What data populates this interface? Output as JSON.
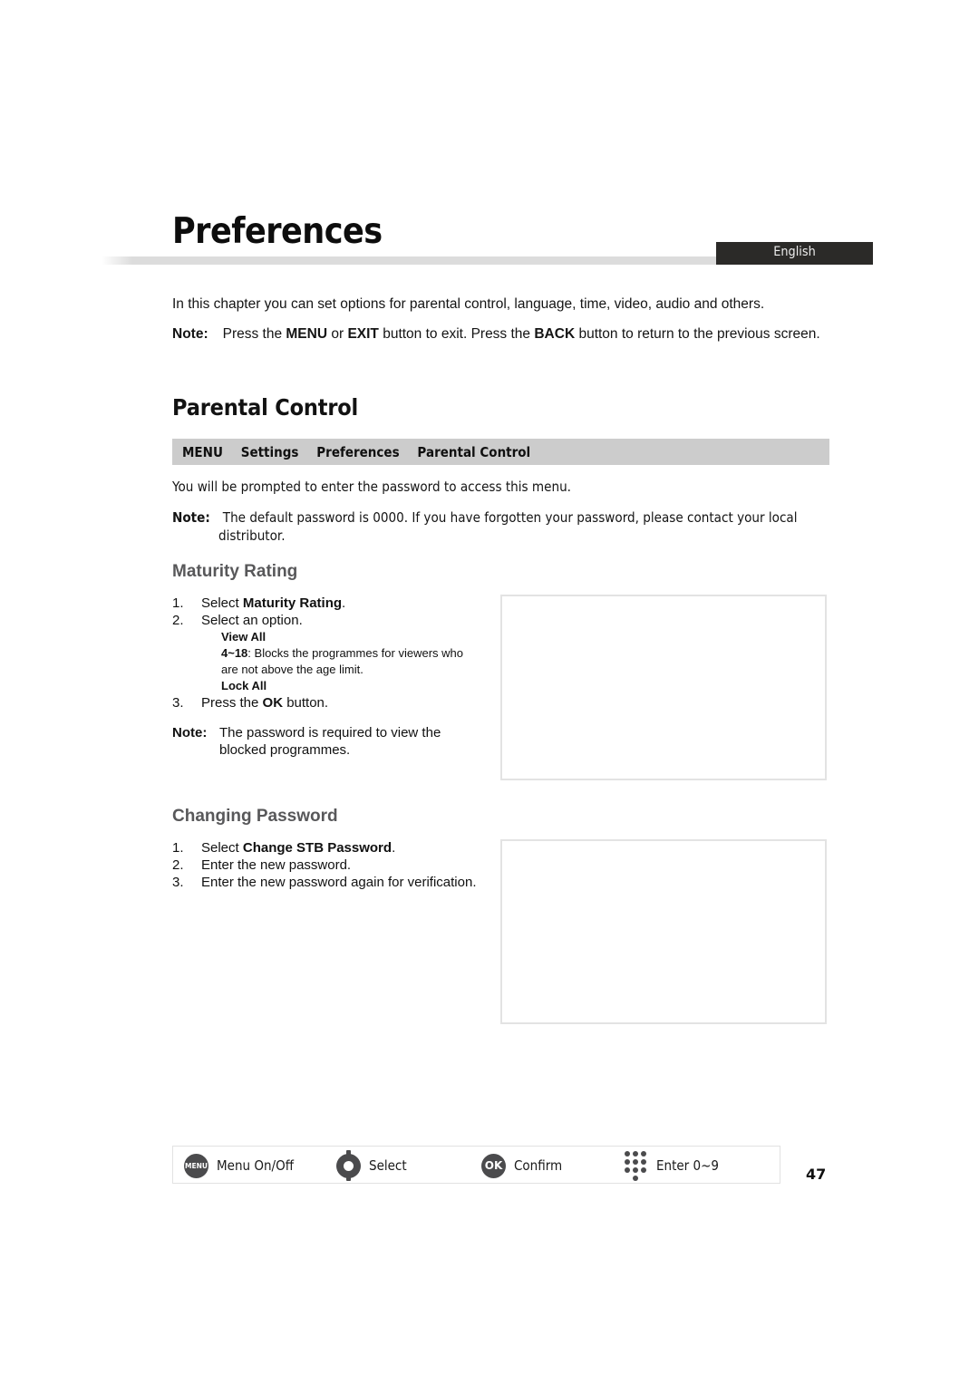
{
  "header": {
    "chapter_title": "Preferences",
    "language_tab": "English"
  },
  "intro": {
    "paragraph": "In this chapter you can set options for parental control, language, time, video, audio and others.",
    "note_label": "Note:",
    "note_part_1": "Press the ",
    "note_key_1": "MENU",
    "note_part_2": " or ",
    "note_key_2": "EXIT",
    "note_part_3": " button to exit. Press the ",
    "note_key_3": "BACK",
    "note_part_4": " button to return to the previous screen."
  },
  "parental_control": {
    "section_title": "Parental Control",
    "breadcrumb": [
      "MENU",
      "Settings",
      "Preferences",
      "Parental Control"
    ],
    "intro_line": "You will be prompted to enter the password to access this menu.",
    "note_label": "Note:",
    "note_line_1": "The default password is 0000. If you have forgotten your password, please contact your local",
    "note_line_2": "distributor."
  },
  "maturity_rating": {
    "heading": "Maturity Rating",
    "steps": [
      {
        "num": "1.",
        "prefix": "Select ",
        "bold": "Maturity Rating",
        "suffix": "."
      },
      {
        "num": "2.",
        "prefix": "Select an option.",
        "bold": "",
        "suffix": ""
      },
      {
        "num": "3.",
        "prefix": "Press the ",
        "bold": "OK",
        "suffix": " button."
      }
    ],
    "options": {
      "view_all": "View All",
      "range_label": "4~18",
      "range_text_1": ": Blocks the programmes for viewers who",
      "range_text_2": "are not above the age limit.",
      "lock_all": "Lock All"
    },
    "note_label": "Note:",
    "note_line_1": "The password is required to view the",
    "note_line_2": "blocked programmes."
  },
  "changing_password": {
    "heading": "Changing Password",
    "steps": [
      {
        "num": "1.",
        "prefix": "Select ",
        "bold": "Change STB Password",
        "suffix": "."
      },
      {
        "num": "2.",
        "prefix": "Enter the new password.",
        "bold": "",
        "suffix": ""
      },
      {
        "num": "3.",
        "prefix": "Enter the new password again for verification.",
        "bold": "",
        "suffix": ""
      }
    ]
  },
  "footer": {
    "legend": [
      {
        "icon": "menu-button-icon",
        "icon_text": "MENU",
        "label": "Menu On/Off"
      },
      {
        "icon": "navigation-ring-icon",
        "icon_text": "",
        "label": "Select"
      },
      {
        "icon": "ok-button-icon",
        "icon_text": "OK",
        "label": "Confirm"
      },
      {
        "icon": "numeric-keypad-icon",
        "icon_text": "",
        "label": "Enter 0~9"
      }
    ],
    "page_number": "47"
  },
  "colors": {
    "lang_tab_bg": "#2b2a28",
    "breadcrumb_bg": "#cccccc",
    "sub_heading": "#58585a",
    "icon_fill": "#4b4b4d",
    "rule_gradient_end": "#dcdcdc"
  }
}
